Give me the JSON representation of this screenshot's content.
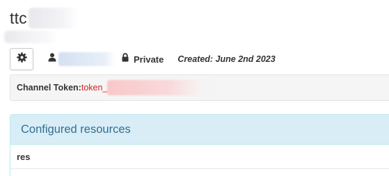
{
  "channel": {
    "title": "ttc",
    "visibility": "Private",
    "created": "Created: June 2nd 2023"
  },
  "token": {
    "label": "Channel Token:",
    "value_prefix": "token_"
  },
  "resources_panel": {
    "title": "Configured resources",
    "rows": [
      {
        "label": "res"
      }
    ]
  },
  "icons": {
    "settings": "gear-icon",
    "owner": "user-icon",
    "visibility": "lock-icon"
  },
  "colors": {
    "panel_heading_bg": "#d9edf7",
    "panel_title": "#31708f",
    "token_value": "#d9201c"
  }
}
